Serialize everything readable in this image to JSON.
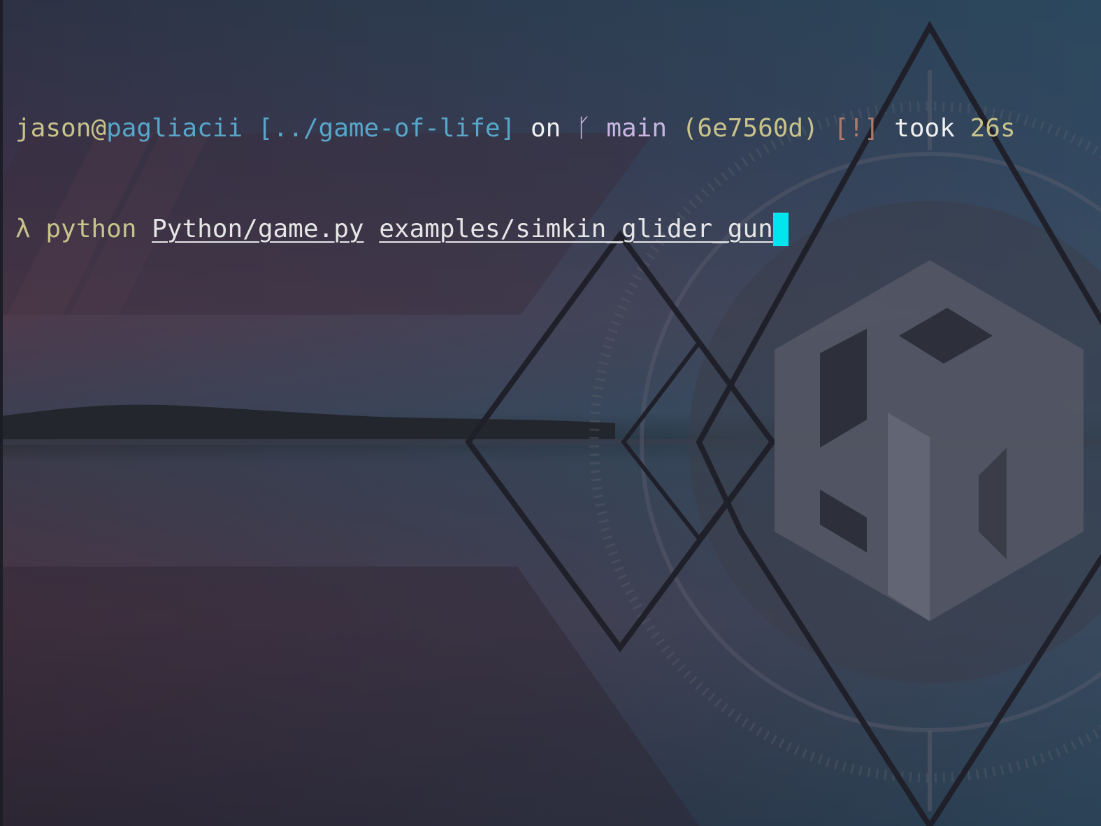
{
  "prompt": {
    "user": "jason",
    "at": "@",
    "host": "pagliacii",
    "path": "[../game-of-life]",
    "on": "on",
    "branch_symbol": "ᚴ",
    "branch": "main",
    "commit": "(6e7560d)",
    "status": "[!]",
    "took": "took",
    "duration": "26s"
  },
  "command": {
    "symbol": "λ",
    "program": "python",
    "arg1": "Python/game.py",
    "arg2": "examples/simkin_glider_gun"
  },
  "colors": {
    "user": "#c8c38a",
    "host": "#58a6c9",
    "path": "#58a6c9",
    "bracket": "#d8d8d8",
    "keyword": "#f0f0f0",
    "branch": "#c9b6e0",
    "commit": "#c8c38a",
    "status": "#b07a6a",
    "duration": "#c8c38a",
    "command_symbol": "#c8c38a",
    "program": "#c8c38a",
    "cursor": "#00e5ee"
  },
  "icons": {
    "branch": "git-branch-icon"
  }
}
